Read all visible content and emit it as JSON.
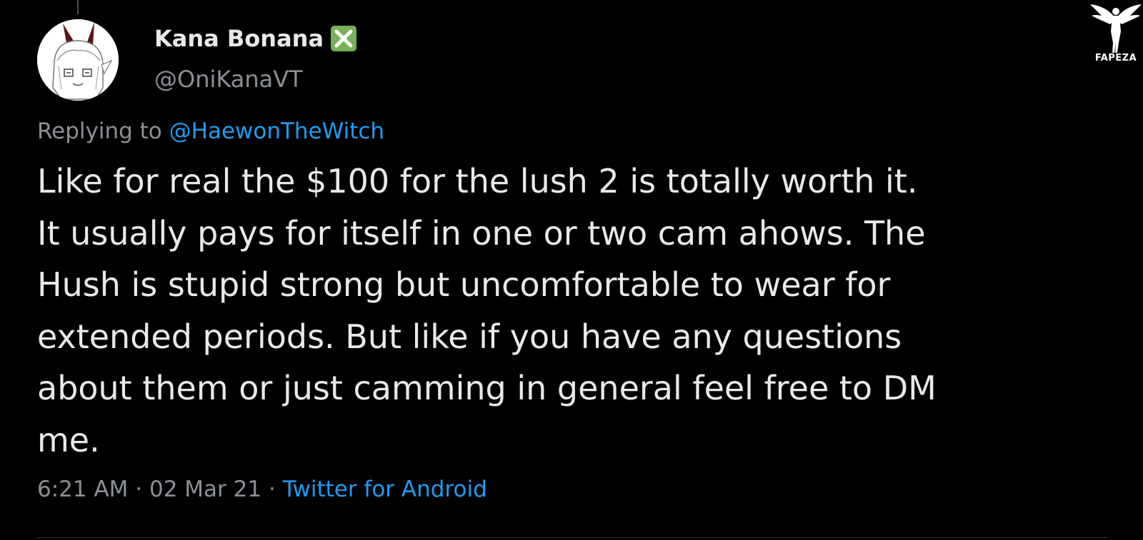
{
  "tweet": {
    "display_name": "Kana Bonana",
    "handle": "@OniKanaVT",
    "replying_prefix": "Replying to",
    "replying_to": "@HaewonTheWitch",
    "text_lines": [
      "Like for real the $100 for the lush 2 is totally worth it.",
      "It usually pays for itself in one or two cam ahows. The",
      "Hush is stupid strong but uncomfortable to wear for",
      "extended periods. But like if you have any questions",
      "about them or just camming in general feel free to DM",
      "me."
    ],
    "time": "6:21 AM",
    "separator": "·",
    "date": "02 Mar 21",
    "source": "Twitter for Android"
  },
  "icons": {
    "avatar": "avatar-oni-girl",
    "verified": "verified-check-icon"
  },
  "watermark": {
    "text": "FAPEZA"
  },
  "colors": {
    "background": "#000000",
    "primary_text": "#e7e9ea",
    "secondary_text": "#8b9096",
    "link": "#1d9bf0",
    "verified_green": "#78b159"
  }
}
